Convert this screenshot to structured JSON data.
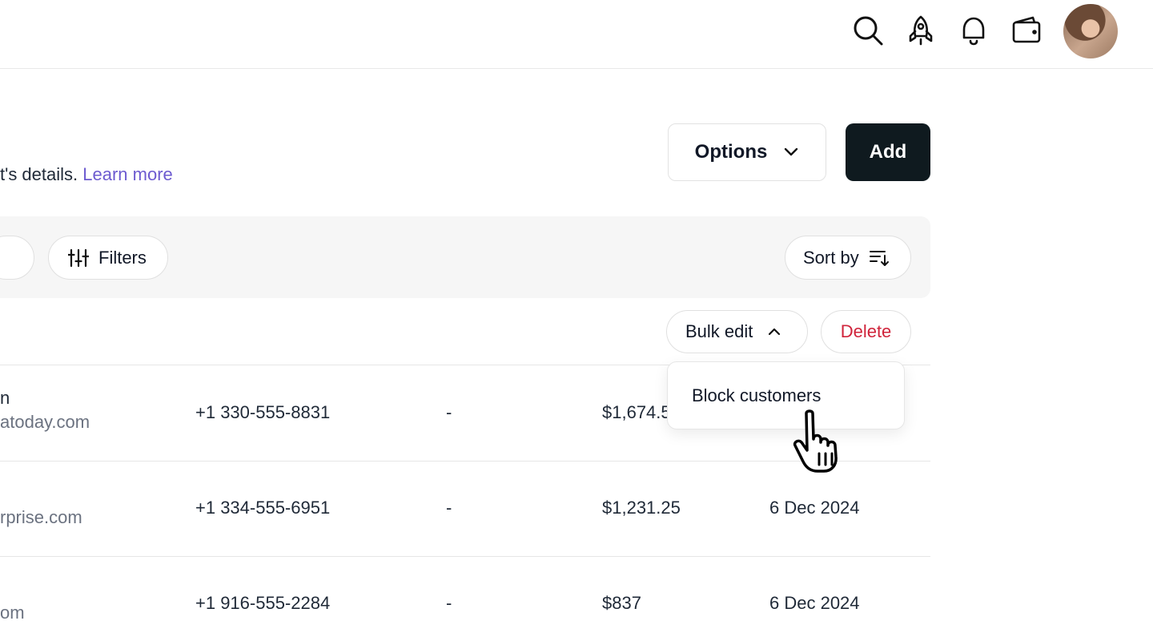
{
  "header": {
    "icons": [
      "search-icon",
      "rocket-icon",
      "bell-icon",
      "wallet-icon"
    ],
    "avatar": "avatar"
  },
  "page": {
    "description_prefix": "t's details.",
    "learn_more": "Learn more",
    "options_label": "Options",
    "add_label": "Add"
  },
  "toolbar": {
    "filters_label": "Filters",
    "sort_label": "Sort by",
    "bulk_edit_label": "Bulk edit",
    "delete_label": "Delete"
  },
  "bulk_menu": {
    "items": [
      {
        "label": "Block customers"
      }
    ]
  },
  "rows": [
    {
      "name": "n",
      "email": "atoday.com",
      "phone": "+1 330-555-8831",
      "col3": "-",
      "amount": "$1,674.5",
      "date": ""
    },
    {
      "name": "",
      "email": "rprise.com",
      "phone": "+1 334-555-6951",
      "col3": "-",
      "amount": "$1,231.25",
      "date": "6 Dec 2024"
    },
    {
      "name": "",
      "email": "om",
      "phone": "+1 916-555-2284",
      "col3": "-",
      "amount": "$837",
      "date": "6 Dec 2024"
    }
  ],
  "colors": {
    "primary_dark": "#0f1a1f",
    "link": "#6d5bd0",
    "danger": "#d0243b"
  }
}
